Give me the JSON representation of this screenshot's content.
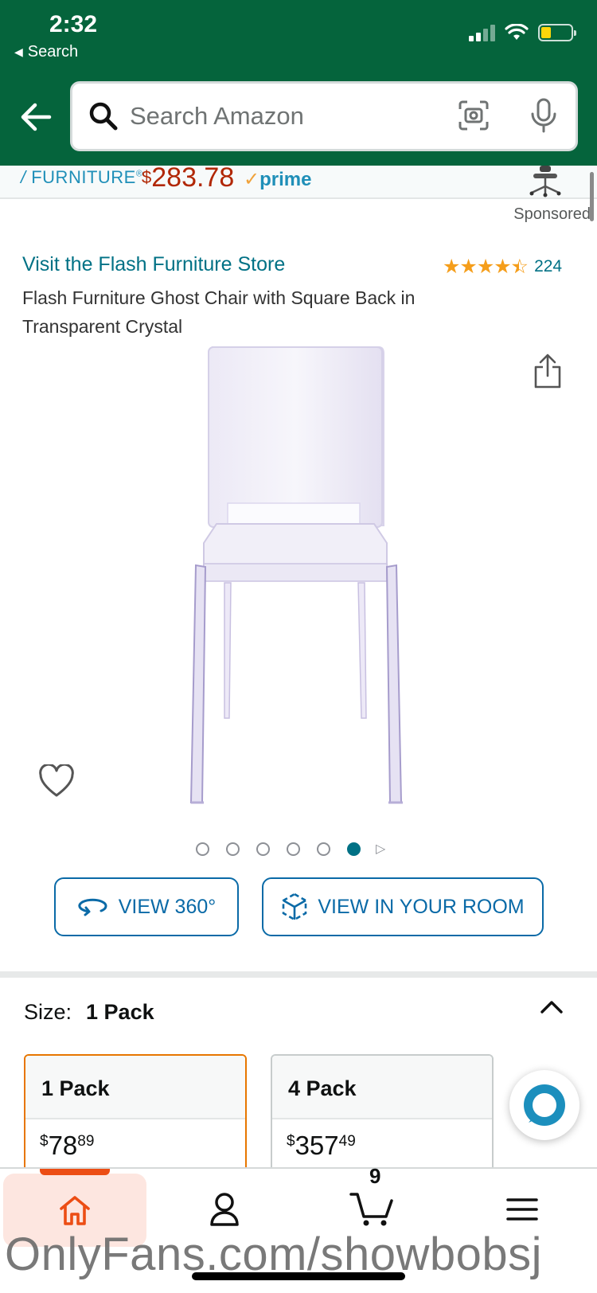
{
  "status_bar": {
    "time": "2:32",
    "back_label": "Search"
  },
  "search": {
    "placeholder": "Search Amazon"
  },
  "ad": {
    "brand": "FURNITURE",
    "brand_mark": "®",
    "currency": "$",
    "price": "283.78",
    "prime_label": "prime",
    "sponsored_label": "Sponsored"
  },
  "product": {
    "store_link": "Visit the Flash Furniture Store",
    "rating_stars": 4.5,
    "rating_count": "224",
    "title": "Flash Furniture Ghost Chair with Square Back in Transparent Crystal"
  },
  "carousel": {
    "image_count": 6,
    "active_index": 5
  },
  "actions": {
    "view_360": "VIEW 360°",
    "view_in_room": "VIEW IN YOUR ROOM"
  },
  "size": {
    "label": "Size:",
    "selected": "1 Pack",
    "options": [
      {
        "name": "1 Pack",
        "currency": "$",
        "dollars": "78",
        "cents": "89",
        "selected": true
      },
      {
        "name": "4 Pack",
        "currency": "$",
        "dollars": "357",
        "cents": "49",
        "selected": false
      }
    ]
  },
  "tabbar": {
    "cart_count": "9",
    "active_tab": "home"
  },
  "watermark": "OnlyFans.com/showbobsj",
  "colors": {
    "header_green": "#05643c",
    "link_teal": "#007185",
    "price_red": "#b12704",
    "star_orange": "#f59e1b",
    "button_blue": "#0a6aa7",
    "selected_orange": "#e77600",
    "home_accent": "#ec4d14"
  }
}
